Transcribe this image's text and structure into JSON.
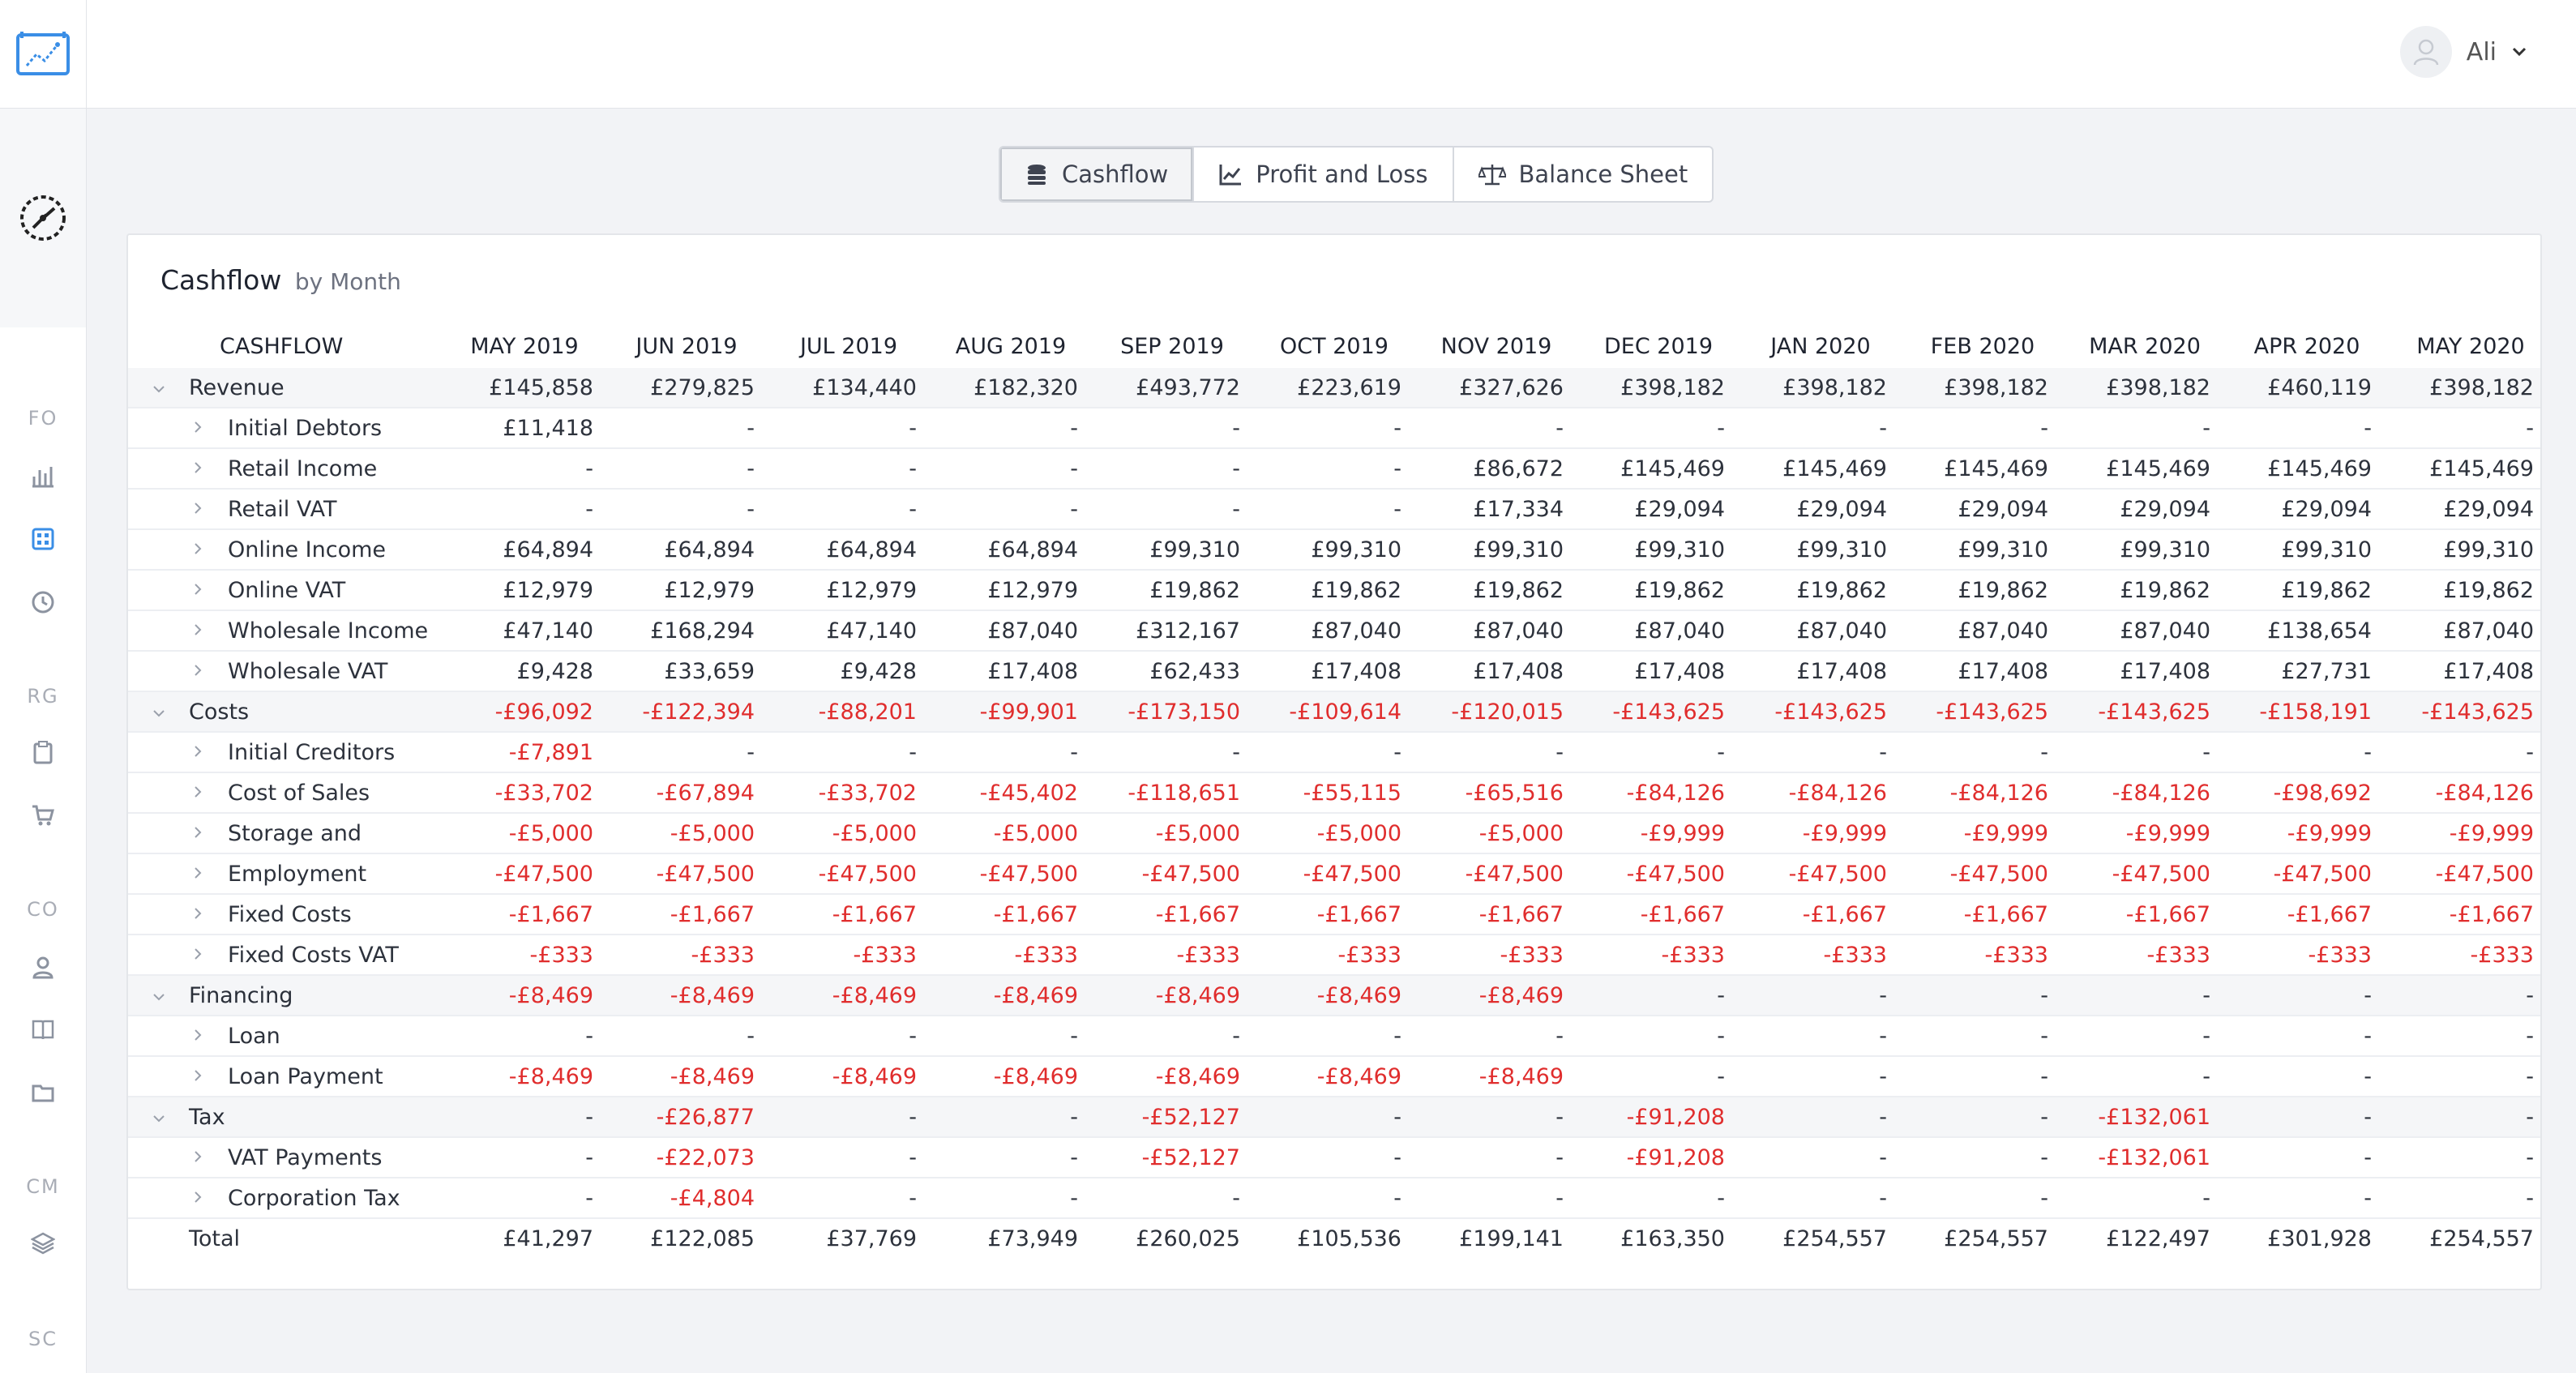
{
  "header": {
    "user_name": "Ali"
  },
  "sidebar": {
    "sections": [
      "FO",
      "RG",
      "CO",
      "CM",
      "SC"
    ],
    "icons": [
      "bar-chart-icon",
      "grid-icon",
      "clock-icon",
      "clipboard-icon",
      "cart-icon",
      "user-tie-icon",
      "book-icon",
      "folder-icon",
      "layers-icon"
    ]
  },
  "tabs": [
    {
      "label": "Cashflow",
      "icon": "coins-icon"
    },
    {
      "label": "Profit and Loss",
      "icon": "line-chart-icon"
    },
    {
      "label": "Balance Sheet",
      "icon": "scales-icon"
    }
  ],
  "card": {
    "title": "Cashflow",
    "subtitle": "by Month"
  },
  "table": {
    "first_header": "CASHFLOW",
    "months": [
      "MAY 2019",
      "JUN 2019",
      "JUL 2019",
      "AUG 2019",
      "SEP 2019",
      "OCT 2019",
      "NOV 2019",
      "DEC 2019",
      "JAN 2020",
      "FEB 2020",
      "MAR 2020",
      "APR 2020",
      "MAY 2020"
    ],
    "rows": [
      {
        "label": "Revenue",
        "level": 0,
        "expanded": true,
        "values": [
          "£145,858",
          "£279,825",
          "£134,440",
          "£182,320",
          "£493,772",
          "£223,619",
          "£327,626",
          "£398,182",
          "£398,182",
          "£398,182",
          "£398,182",
          "£460,119",
          "£398,182"
        ]
      },
      {
        "label": "Initial Debtors",
        "level": 1,
        "values": [
          "£11,418",
          "-",
          "-",
          "-",
          "-",
          "-",
          "-",
          "-",
          "-",
          "-",
          "-",
          "-",
          "-"
        ]
      },
      {
        "label": "Retail Income",
        "level": 1,
        "values": [
          "-",
          "-",
          "-",
          "-",
          "-",
          "-",
          "£86,672",
          "£145,469",
          "£145,469",
          "£145,469",
          "£145,469",
          "£145,469",
          "£145,469"
        ]
      },
      {
        "label": "Retail VAT",
        "level": 1,
        "values": [
          "-",
          "-",
          "-",
          "-",
          "-",
          "-",
          "£17,334",
          "£29,094",
          "£29,094",
          "£29,094",
          "£29,094",
          "£29,094",
          "£29,094"
        ]
      },
      {
        "label": "Online Income",
        "level": 1,
        "values": [
          "£64,894",
          "£64,894",
          "£64,894",
          "£64,894",
          "£99,310",
          "£99,310",
          "£99,310",
          "£99,310",
          "£99,310",
          "£99,310",
          "£99,310",
          "£99,310",
          "£99,310"
        ]
      },
      {
        "label": "Online VAT",
        "level": 1,
        "values": [
          "£12,979",
          "£12,979",
          "£12,979",
          "£12,979",
          "£19,862",
          "£19,862",
          "£19,862",
          "£19,862",
          "£19,862",
          "£19,862",
          "£19,862",
          "£19,862",
          "£19,862"
        ]
      },
      {
        "label": "Wholesale Income",
        "level": 1,
        "values": [
          "£47,140",
          "£168,294",
          "£47,140",
          "£87,040",
          "£312,167",
          "£87,040",
          "£87,040",
          "£87,040",
          "£87,040",
          "£87,040",
          "£87,040",
          "£138,654",
          "£87,040"
        ]
      },
      {
        "label": "Wholesale VAT",
        "level": 1,
        "values": [
          "£9,428",
          "£33,659",
          "£9,428",
          "£17,408",
          "£62,433",
          "£17,408",
          "£17,408",
          "£17,408",
          "£17,408",
          "£17,408",
          "£17,408",
          "£27,731",
          "£17,408"
        ]
      },
      {
        "label": "Costs",
        "level": 0,
        "expanded": true,
        "values": [
          "-£96,092",
          "-£122,394",
          "-£88,201",
          "-£99,901",
          "-£173,150",
          "-£109,614",
          "-£120,015",
          "-£143,625",
          "-£143,625",
          "-£143,625",
          "-£143,625",
          "-£158,191",
          "-£143,625"
        ]
      },
      {
        "label": "Initial Creditors",
        "level": 1,
        "values": [
          "-£7,891",
          "-",
          "-",
          "-",
          "-",
          "-",
          "-",
          "-",
          "-",
          "-",
          "-",
          "-",
          "-"
        ]
      },
      {
        "label": "Cost of Sales",
        "level": 1,
        "values": [
          "-£33,702",
          "-£67,894",
          "-£33,702",
          "-£45,402",
          "-£118,651",
          "-£55,115",
          "-£65,516",
          "-£84,126",
          "-£84,126",
          "-£84,126",
          "-£84,126",
          "-£98,692",
          "-£84,126"
        ]
      },
      {
        "label": "Storage and",
        "level": 1,
        "values": [
          "-£5,000",
          "-£5,000",
          "-£5,000",
          "-£5,000",
          "-£5,000",
          "-£5,000",
          "-£5,000",
          "-£9,999",
          "-£9,999",
          "-£9,999",
          "-£9,999",
          "-£9,999",
          "-£9,999"
        ]
      },
      {
        "label": "Employment",
        "level": 1,
        "values": [
          "-£47,500",
          "-£47,500",
          "-£47,500",
          "-£47,500",
          "-£47,500",
          "-£47,500",
          "-£47,500",
          "-£47,500",
          "-£47,500",
          "-£47,500",
          "-£47,500",
          "-£47,500",
          "-£47,500"
        ]
      },
      {
        "label": "Fixed Costs",
        "level": 1,
        "values": [
          "-£1,667",
          "-£1,667",
          "-£1,667",
          "-£1,667",
          "-£1,667",
          "-£1,667",
          "-£1,667",
          "-£1,667",
          "-£1,667",
          "-£1,667",
          "-£1,667",
          "-£1,667",
          "-£1,667"
        ]
      },
      {
        "label": "Fixed Costs VAT",
        "level": 1,
        "values": [
          "-£333",
          "-£333",
          "-£333",
          "-£333",
          "-£333",
          "-£333",
          "-£333",
          "-£333",
          "-£333",
          "-£333",
          "-£333",
          "-£333",
          "-£333"
        ]
      },
      {
        "label": "Financing",
        "level": 0,
        "expanded": true,
        "values": [
          "-£8,469",
          "-£8,469",
          "-£8,469",
          "-£8,469",
          "-£8,469",
          "-£8,469",
          "-£8,469",
          "-",
          "-",
          "-",
          "-",
          "-",
          "-"
        ]
      },
      {
        "label": "Loan",
        "level": 1,
        "values": [
          "-",
          "-",
          "-",
          "-",
          "-",
          "-",
          "-",
          "-",
          "-",
          "-",
          "-",
          "-",
          "-"
        ]
      },
      {
        "label": "Loan Payment",
        "level": 1,
        "values": [
          "-£8,469",
          "-£8,469",
          "-£8,469",
          "-£8,469",
          "-£8,469",
          "-£8,469",
          "-£8,469",
          "-",
          "-",
          "-",
          "-",
          "-",
          "-"
        ]
      },
      {
        "label": "Tax",
        "level": 0,
        "expanded": true,
        "values": [
          "-",
          "-£26,877",
          "-",
          "-",
          "-£52,127",
          "-",
          "-",
          "-£91,208",
          "-",
          "-",
          "-£132,061",
          "-",
          "-"
        ]
      },
      {
        "label": "VAT Payments",
        "level": 1,
        "values": [
          "-",
          "-£22,073",
          "-",
          "-",
          "-£52,127",
          "-",
          "-",
          "-£91,208",
          "-",
          "-",
          "-£132,061",
          "-",
          "-"
        ]
      },
      {
        "label": "Corporation Tax",
        "level": 1,
        "values": [
          "-",
          "-£4,804",
          "-",
          "-",
          "-",
          "-",
          "-",
          "-",
          "-",
          "-",
          "-",
          "-",
          "-"
        ]
      },
      {
        "label": "Total",
        "level": 2,
        "values": [
          "£41,297",
          "£122,085",
          "£37,769",
          "£73,949",
          "£260,025",
          "£105,536",
          "£199,141",
          "£163,350",
          "£254,557",
          "£254,557",
          "£122,497",
          "£301,928",
          "£254,557"
        ]
      }
    ]
  },
  "colors": {
    "negative": "#e02d2d",
    "accent": "#3a8ee6"
  }
}
